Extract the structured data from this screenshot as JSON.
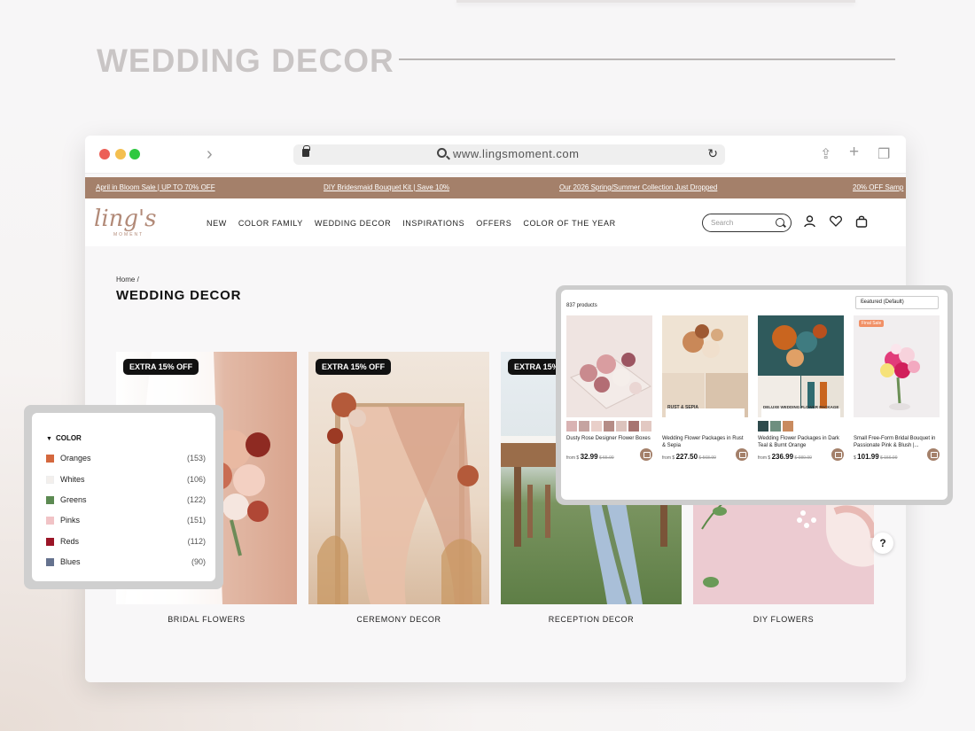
{
  "hero": {
    "title": "WEDDING DECOR"
  },
  "browser": {
    "url": "www.lingsmoment.com",
    "reload_icon": "reload-icon",
    "share_icon": "share-icon",
    "new_tab_icon": "plus-icon",
    "tabs_icon": "tabs-icon"
  },
  "promo": [
    "April in Bloom Sale | UP TO 70% OFF",
    "DIY Bridesmaid Bouquet Kit | Save 10%",
    "Our 2026 Spring/Summer Collection Just Dropped",
    "20% OFF Samp"
  ],
  "logo": {
    "text": "ling's",
    "sub": "MOMENT"
  },
  "nav": [
    "NEW",
    "COLOR FAMILY",
    "WEDDING DECOR",
    "INSPIRATIONS",
    "OFFERS",
    "COLOR OF THE YEAR"
  ],
  "search": {
    "placeholder": "Search"
  },
  "page": {
    "breadcrumb": "Home /",
    "title": "WEDDING DECOR"
  },
  "tiles": [
    {
      "badge": "EXTRA 15% OFF",
      "label": "BRIDAL FLOWERS"
    },
    {
      "badge": "EXTRA 15% OFF",
      "label": "CEREMONY DECOR"
    },
    {
      "badge": "EXTRA 15%",
      "label": "RECEPTION DECOR"
    },
    {
      "badge": "",
      "label": "DIY FLOWERS"
    }
  ],
  "help": "?",
  "filter": {
    "heading": "COLOR",
    "items": [
      {
        "name": "Oranges",
        "count": "(153)",
        "color": "#d4683e"
      },
      {
        "name": "Whites",
        "count": "(106)",
        "color": "#f3efec"
      },
      {
        "name": "Greens",
        "count": "(122)",
        "color": "#5c8a52"
      },
      {
        "name": "Pinks",
        "count": "(151)",
        "color": "#f1c3c6"
      },
      {
        "name": "Reds",
        "count": "(112)",
        "color": "#9b1527"
      },
      {
        "name": "Blues",
        "count": "(90)",
        "color": "#65728e"
      }
    ]
  },
  "products": {
    "count": "837 products",
    "sort": "Featured (Default)",
    "items": [
      {
        "name": "Dusty Rose Designer Flower Boxes",
        "from": "from $",
        "price": "32.99",
        "was": "$ 55.99",
        "sale": ""
      },
      {
        "name": "Wedding Flower Packages in Rust & Sepia",
        "from": "from $",
        "price": "227.50",
        "was": "$ 568.99",
        "sale": "",
        "banner": "RUST & SEPIA"
      },
      {
        "name": "Wedding Flower Packages in Dark Teal & Burnt Orange",
        "from": "from $",
        "price": "236.99",
        "was": "$ 989.99",
        "sale": "",
        "banner": "DELUXE WEDDING FLOWER PACKAGE"
      },
      {
        "name": "Small Free-Form Bridal Bouquet in Passionate Pink & Blush |...",
        "from": "$",
        "price": "101.99",
        "was": "$ 156.99",
        "sale": "Final Sale"
      }
    ]
  },
  "colors": {
    "promo_bg": "#a4806a",
    "accent": "#a4806a"
  }
}
